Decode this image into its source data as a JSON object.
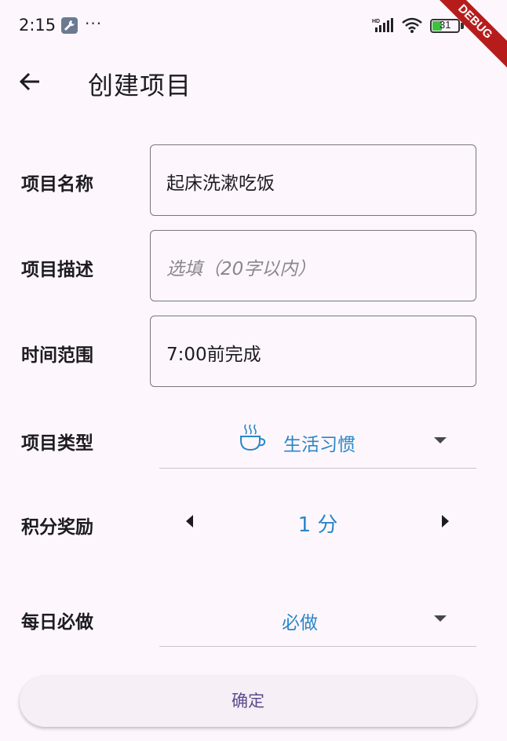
{
  "status": {
    "time": "2:15",
    "dots": "···",
    "battery": "31",
    "debug_label": "DEBUG"
  },
  "appbar": {
    "title": "创建项目"
  },
  "form": {
    "name": {
      "label": "项目名称",
      "value": "起床洗漱吃饭"
    },
    "description": {
      "label": "项目描述",
      "placeholder": "选填（20字以内）"
    },
    "time_range": {
      "label": "时间范围",
      "value": "7:00前完成"
    },
    "type": {
      "label": "项目类型",
      "selected": "生活习惯",
      "icon": "coffee-cup-icon"
    },
    "points": {
      "label": "积分奖励",
      "value": "1 分"
    },
    "daily": {
      "label": "每日必做",
      "selected": "必做"
    }
  },
  "confirm_label": "确定",
  "colors": {
    "background": "#fdf7fd",
    "accent": "#2a86c7",
    "button_text": "#5d4a8e"
  }
}
